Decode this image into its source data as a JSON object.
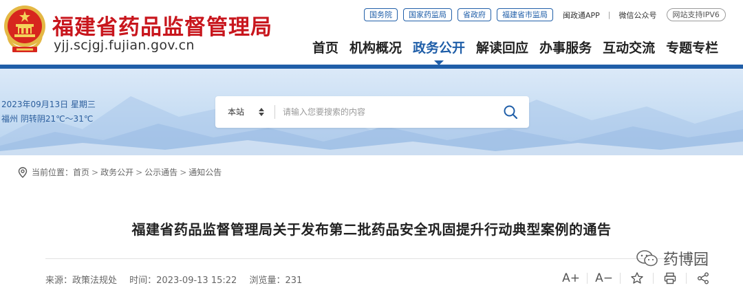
{
  "header": {
    "site_title": "福建省药品监督管理局",
    "site_domain": "yjj.scjgj.fujian.gov.cn",
    "top_links": [
      "国务院",
      "国家药监局",
      "省政府",
      "福建省市监局"
    ],
    "app_link": "闽政通APP",
    "wechat_link": "微信公众号",
    "ipv6_badge": "网站支持IPV6",
    "nav": [
      "首页",
      "机构概况",
      "政务公开",
      "解读回应",
      "办事服务",
      "互动交流",
      "专题专栏"
    ],
    "active_nav": "政务公开"
  },
  "banner": {
    "date": "2023年09月13日 星期三",
    "weather": "福州 阴转阴21℃～31℃",
    "search_scope": "本站",
    "search_placeholder": "请输入您要搜索的内容"
  },
  "breadcrumb": {
    "label": "当前位置：",
    "items": [
      "首页",
      "政务公开",
      "公示通告",
      "通知公告"
    ]
  },
  "article": {
    "title": "福建省药品监督管理局关于发布第二批药品安全巩固提升行动典型案例的通告",
    "source": "来源：政策法规处",
    "time": "时间：2023-09-13 15:22",
    "views": "浏览量：231"
  },
  "tools": {
    "font_larger": "A+",
    "font_smaller": "A−"
  },
  "watermark": {
    "text": "药博园"
  },
  "colors": {
    "brand_red": "#c8161d",
    "brand_blue": "#1f5ea8"
  }
}
